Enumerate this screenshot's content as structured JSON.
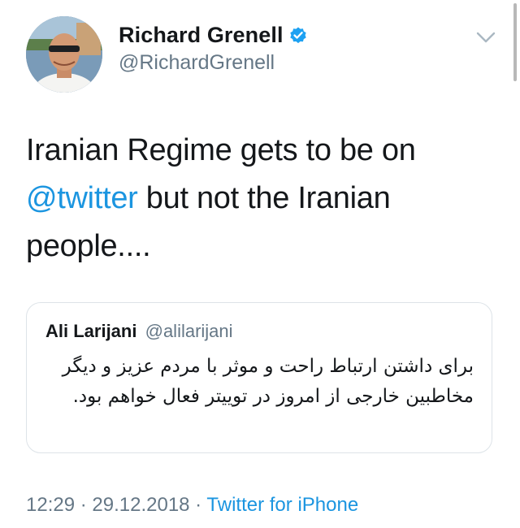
{
  "author": {
    "display_name": "Richard Grenell",
    "handle": "@RichardGrenell",
    "verified": true,
    "avatar_icon": "profile-photo"
  },
  "tweet": {
    "text_part1": "Iranian Regime gets to be on ",
    "mention": "@twitter",
    "text_part2": " but not the Iranian people...."
  },
  "quoted_tweet": {
    "display_name": "Ali Larijani",
    "handle": "@alilarijani",
    "text": "برای داشتن ارتباط راحت و موثر با مردم عزیز و دیگر مخاطبین خارجی از امروز در توییتر فعال خواهم بود."
  },
  "meta": {
    "time": "12:29",
    "separator": " · ",
    "date": "29.12.2018",
    "source": "Twitter for iPhone"
  },
  "colors": {
    "link": "#1b95e0",
    "secondary_text": "#657786",
    "border": "#dde3e8",
    "verified": "#1da1f2"
  },
  "icons": {
    "verified": "verified-badge-icon",
    "more": "chevron-down-icon"
  }
}
